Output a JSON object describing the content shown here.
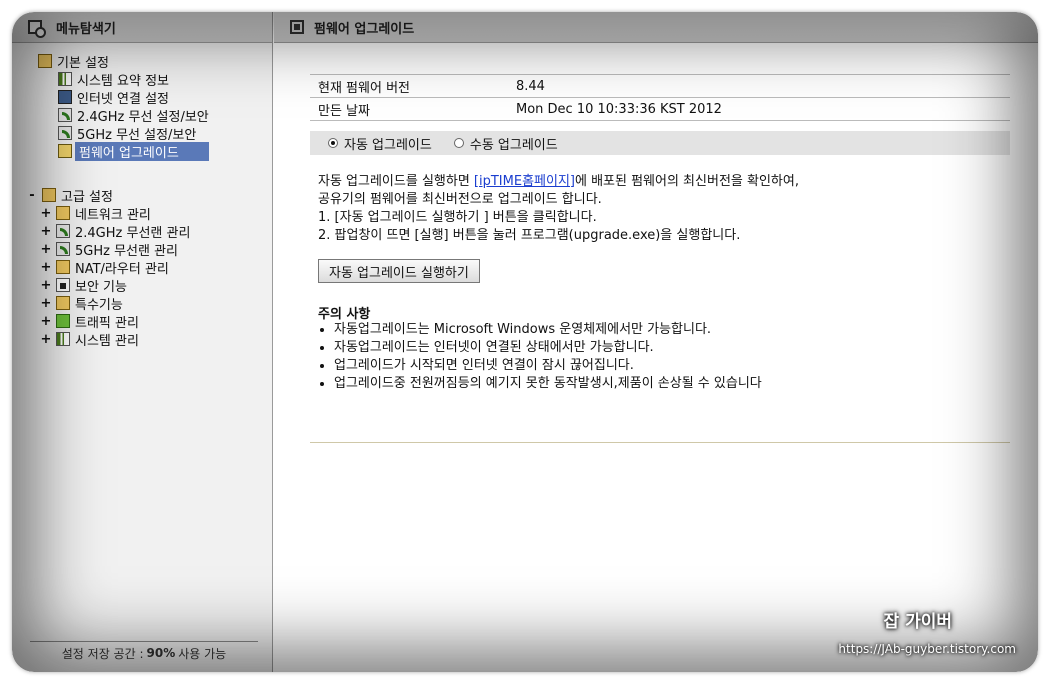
{
  "left_panel": {
    "title": "메뉴탐색기",
    "basic_group": {
      "title": "기본 설정",
      "items": [
        {
          "label": "시스템 요약 정보",
          "icon": "chart-icon"
        },
        {
          "label": "인터넷 연결 설정",
          "icon": "monitor-icon"
        },
        {
          "label": "2.4GHz 무선 설정/보안",
          "icon": "wifi-icon"
        },
        {
          "label": "5GHz 무선 설정/보안",
          "icon": "wifi-icon"
        },
        {
          "label": "펌웨어 업그레이드",
          "icon": "firmware-icon",
          "selected": true
        }
      ]
    },
    "advanced_group": {
      "toggle": "-",
      "title": "고급 설정",
      "items": [
        {
          "label": "네트워크 관리",
          "toggle": "+"
        },
        {
          "label": "2.4GHz 무선랜 관리",
          "toggle": "+"
        },
        {
          "label": "5GHz 무선랜 관리",
          "toggle": "+"
        },
        {
          "label": "NAT/라우터 관리",
          "toggle": "+"
        },
        {
          "label": "보안 기능",
          "toggle": "+"
        },
        {
          "label": "특수기능",
          "toggle": "+"
        },
        {
          "label": "트래픽 관리",
          "toggle": "+"
        },
        {
          "label": "시스템 관리",
          "toggle": "+"
        }
      ]
    },
    "footer": {
      "prefix": "설정 저장 공간 :",
      "percent": "90%",
      "suffix": "사용 가능"
    }
  },
  "main": {
    "title": "펌웨어 업그레이드",
    "info": {
      "version_label": "현재 펌웨어 버전",
      "version_value": "8.44",
      "date_label": "만든 날짜",
      "date_value": "Mon Dec 10 10:33:36 KST 2012"
    },
    "modes": {
      "auto": "자동 업그레이드",
      "manual": "수동 업그레이드",
      "selected": "auto"
    },
    "description": {
      "line1_pre": "자동 업그레이드를 실행하면 ",
      "link": "[ipTIME홈페이지]",
      "line1_post": "에 배포된 펌웨어의 최신버전을 확인하여,",
      "line2": "공유기의 펌웨어를 최신버전으로 업그레이드 합니다.",
      "line3": "1. [자동 업그레이드 실행하기 ] 버튼을 클릭합니다.",
      "line4": "2. 팝업창이 뜨면 [실행] 버튼을 눌러 프로그램(upgrade.exe)을 실행합니다."
    },
    "run_button": "자동 업그레이드 실행하기",
    "notes": {
      "title": "주의 사항",
      "items": [
        "자동업그레이드는 Microsoft Windows 운영체제에서만 가능합니다.",
        "자동업그레이드는 인터넷이 연결된 상태에서만 가능합니다.",
        "업그레이드가 시작되면 인터넷 연결이 잠시 끊어집니다.",
        "업그레이드중 전원꺼짐등의 예기지 못한 동작발생시,제품이 손상될 수 있습니다"
      ]
    }
  },
  "watermark": {
    "title": "잡 가이버",
    "url": "https://JAb-guyber.tistory.com"
  },
  "colors": {
    "selected": "#5a79b8",
    "link": "#1a3dcf",
    "header": "#cfcfcf"
  }
}
